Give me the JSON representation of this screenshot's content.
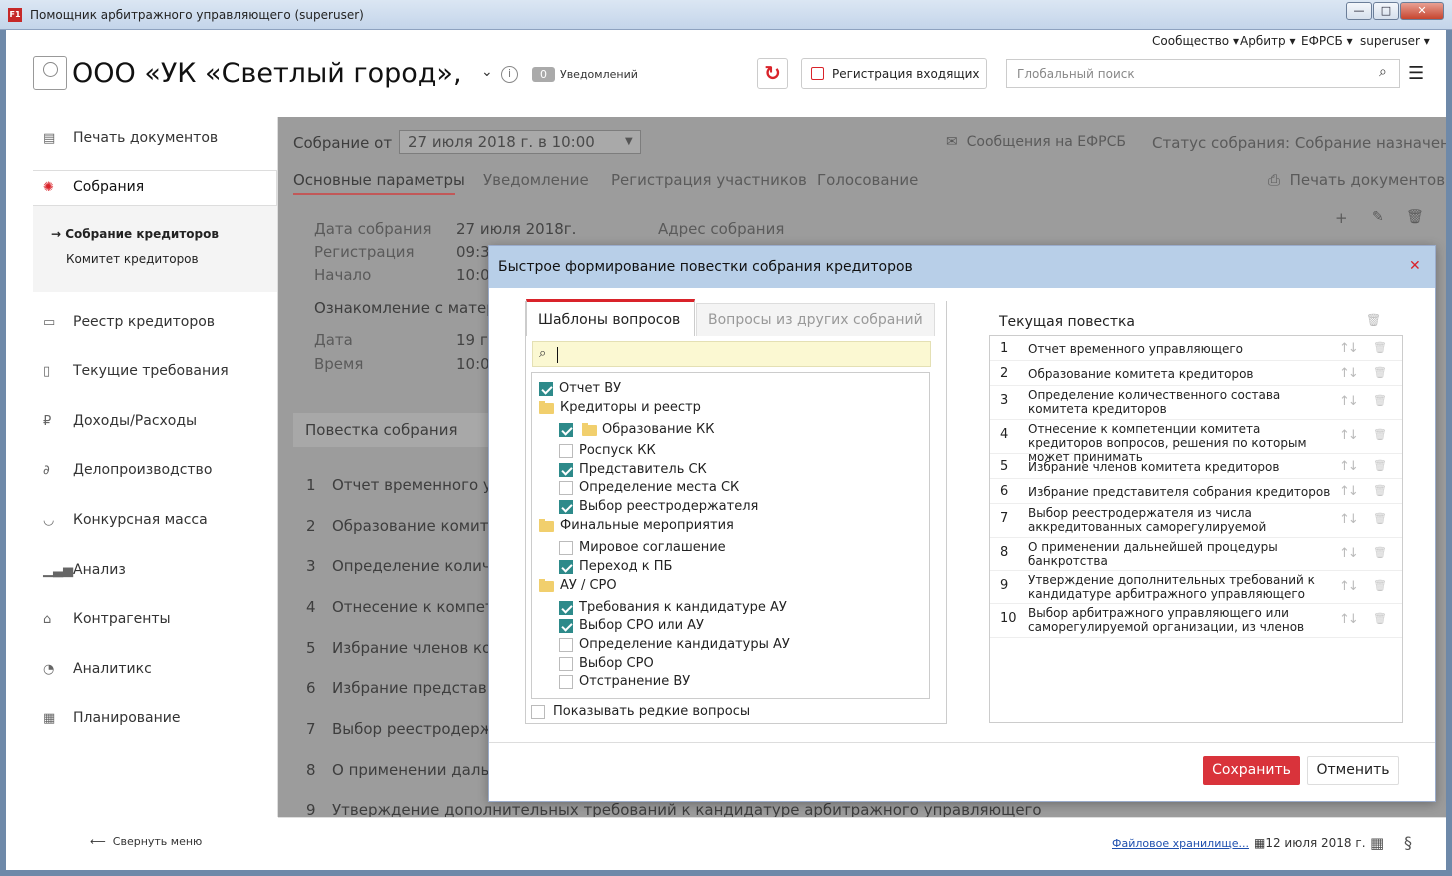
{
  "window": {
    "title": "Помощник арбитражного управляющего (superuser)",
    "app_icon": "F1"
  },
  "header": {
    "links": [
      "Сообщество",
      "Арбитр",
      "ЕФРСБ",
      "superuser"
    ],
    "company": "ООО «УК «Светлый город», Н",
    "notifications_count": "0",
    "notifications_label": "Уведомлений",
    "register_button": "Регистрация входящих",
    "search_placeholder": "Глобальный поиск"
  },
  "sidebar": {
    "items": [
      {
        "label": "Печать документов",
        "icon": "print-doc-icon"
      },
      {
        "label": "Собрания",
        "icon": "handshake-icon"
      },
      {
        "label": "Реестр кредиторов",
        "icon": "registry-icon"
      },
      {
        "label": "Текущие требования",
        "icon": "bottle-icon"
      },
      {
        "label": "Доходы/Расходы",
        "icon": "ruble-icon"
      },
      {
        "label": "Делопроизводство",
        "icon": "paperclip-icon"
      },
      {
        "label": "Конкурсная масса",
        "icon": "basket-icon"
      },
      {
        "label": "Анализ",
        "icon": "bar-chart-icon"
      },
      {
        "label": "Контрагенты",
        "icon": "bank-icon"
      },
      {
        "label": "Аналитикс",
        "icon": "gauge-icon"
      },
      {
        "label": "Планирование",
        "icon": "calendar-icon"
      }
    ],
    "submenu": [
      "→ Собрание кредиторов",
      "Комитет кредиторов"
    ],
    "collapse_label": "Свернуть меню"
  },
  "main": {
    "meeting_label": "Собрание от",
    "meeting_date": "27 июля 2018 г. в 10:00",
    "efrsb_messages": "Сообщения на ЕФРСБ",
    "status": "Статус собрания: Собрание назначено",
    "tabs": [
      "Основные параметры",
      "Уведомление",
      "Регистрация участников",
      "Голосование"
    ],
    "print_docs": "Печать документов",
    "fields": [
      {
        "label": "Дата собрания",
        "value": "27 июля 2018г."
      },
      {
        "label": "Регистрация",
        "value": "09:3"
      },
      {
        "label": "Начало",
        "value": "10:0"
      }
    ],
    "address_label": "Адрес собрания",
    "review_label": "Ознакомление с матер",
    "review_fields": [
      {
        "label": "Дата",
        "value": "19 г"
      },
      {
        "label": "Время",
        "value": "10:0"
      }
    ],
    "agenda_title": "Повестка собрания",
    "agenda": [
      {
        "num": "1",
        "text": "Отчет временного у"
      },
      {
        "num": "2",
        "text": "Образование комит"
      },
      {
        "num": "3",
        "text": "Определение колич"
      },
      {
        "num": "4",
        "text": "Отнесение к компет"
      },
      {
        "num": "5",
        "text": "Избрание членов ко"
      },
      {
        "num": "6",
        "text": "Избрание представі"
      },
      {
        "num": "7",
        "text": "Выбор реестродерж"
      },
      {
        "num": "8",
        "text": "О применении даль"
      },
      {
        "num": "9",
        "text": "Утверждение дополнительных требований к кандидатуре арбитражного управляющего"
      }
    ]
  },
  "dialog": {
    "title": "Быстрое формирование повестки собрания кредиторов",
    "tabs": [
      "Шаблоны вопросов",
      "Вопросы из других собраний"
    ],
    "tree": [
      {
        "label": "Отчет ВУ",
        "type": "check",
        "checked": true,
        "level": 0
      },
      {
        "label": "Кредиторы и реестр",
        "type": "folder",
        "level": 0
      },
      {
        "label": "Образование КК",
        "type": "checkfolder",
        "checked": true,
        "level": 1
      },
      {
        "label": "Роспуск КК",
        "type": "check",
        "checked": false,
        "level": 1
      },
      {
        "label": "Представитель СК",
        "type": "check",
        "checked": true,
        "level": 1
      },
      {
        "label": "Определение места СК",
        "type": "check",
        "checked": false,
        "level": 1
      },
      {
        "label": "Выбор реестродержателя",
        "type": "check",
        "checked": true,
        "level": 1
      },
      {
        "label": "Финальные мероприятия",
        "type": "folder",
        "level": 0
      },
      {
        "label": "Мировое соглашение",
        "type": "check",
        "checked": false,
        "level": 1
      },
      {
        "label": "Переход к ПБ",
        "type": "check",
        "checked": true,
        "level": 1
      },
      {
        "label": "АУ / СРО",
        "type": "folder",
        "level": 0
      },
      {
        "label": "Требования к кандидатуре АУ",
        "type": "check",
        "checked": true,
        "level": 1
      },
      {
        "label": "Выбор СРО или АУ",
        "type": "check",
        "checked": true,
        "level": 1
      },
      {
        "label": "Определение кандидатуры АУ",
        "type": "check",
        "checked": false,
        "level": 1
      },
      {
        "label": "Выбор СРО",
        "type": "check",
        "checked": false,
        "level": 1
      },
      {
        "label": "Отстранение ВУ",
        "type": "check",
        "checked": false,
        "level": 1
      }
    ],
    "rare_label": "Показывать редкие вопросы",
    "current_title": "Текущая повестка",
    "current": [
      {
        "num": "1",
        "text": "Отчет временного управляющего"
      },
      {
        "num": "2",
        "text": "Образование комитета кредиторов"
      },
      {
        "num": "3",
        "text": "Определение количественного состава комитета кредиторов"
      },
      {
        "num": "4",
        "text": "Отнесение к компетенции комитета кредиторов вопросов, решения по которым может принимать"
      },
      {
        "num": "5",
        "text": "Избрание членов комитета кредиторов"
      },
      {
        "num": "6",
        "text": "Избрание представителя собрания кредиторов"
      },
      {
        "num": "7",
        "text": "Выбор реестродержателя из числа аккредитованных саморегулируемой"
      },
      {
        "num": "8",
        "text": "О применении дальнейшей процедуры банкротства"
      },
      {
        "num": "9",
        "text": "Утверждение дополнительных требований к кандидатуре арбитражного управляющего"
      },
      {
        "num": "10",
        "text": "Выбор арбитражного управляющего или саморегулируемой организации, из членов"
      }
    ],
    "save": "Сохранить",
    "cancel": "Отменить"
  },
  "status": {
    "files": "Файловое хранилище...",
    "date": "12 июля 2018 г."
  }
}
